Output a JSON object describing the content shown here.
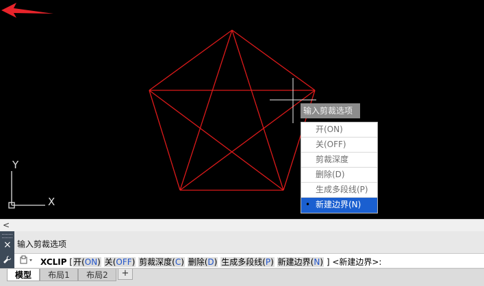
{
  "canvas": {
    "ucs_y_label": "Y",
    "ucs_x_label": "X",
    "line_color": "#dd1a1a"
  },
  "tooltip": {
    "text": "输入剪裁选项"
  },
  "menu": {
    "items": [
      {
        "label": "开(ON)"
      },
      {
        "label": "关(OFF)"
      },
      {
        "label": "剪裁深度"
      },
      {
        "label": "删除(D)"
      },
      {
        "label": "生成多段线(P)"
      },
      {
        "label": "新建边界(N)",
        "selected": true,
        "bullet": "•"
      }
    ],
    "highlight_color": "#1a5fd0"
  },
  "command": {
    "history": "输入剪裁选项",
    "name": "XCLIP",
    "open_bracket": "[",
    "options": [
      {
        "label": "开(",
        "key": "ON",
        "close": ")"
      },
      {
        "label": "关(",
        "key": "OFF",
        "close": ")"
      },
      {
        "label": "剪裁深度(",
        "key": "C",
        "close": ")"
      },
      {
        "label": "删除(",
        "key": "D",
        "close": ")"
      },
      {
        "label": "生成多段线(",
        "key": "P",
        "close": ")"
      },
      {
        "label": "新建边界(",
        "key": "N",
        "close": ")"
      }
    ],
    "suffix": "] <新建边界>:"
  },
  "layout_tabs": [
    {
      "label": "模型",
      "active": true
    },
    {
      "label": "布局1"
    },
    {
      "label": "布局2"
    }
  ],
  "add_tab_label": "+",
  "icons": {
    "close": "×",
    "wrench": "🔧",
    "scroll_left": "<",
    "cmd_icon": "⌖"
  }
}
